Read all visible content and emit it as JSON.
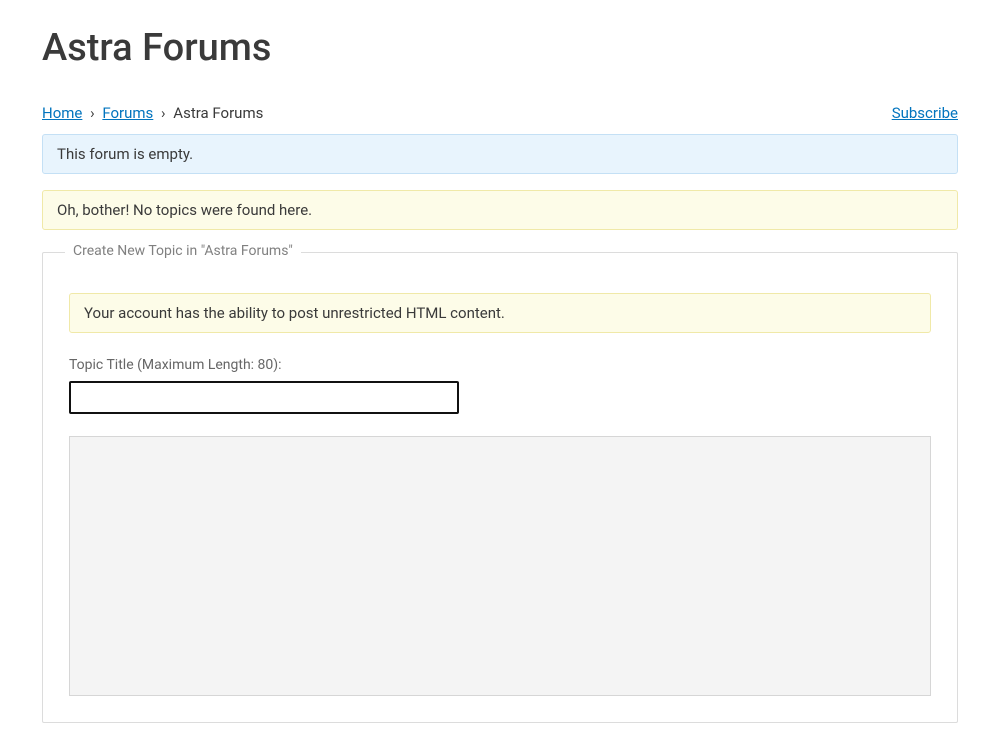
{
  "page": {
    "title": "Astra Forums"
  },
  "breadcrumb": {
    "home": "Home",
    "forums": "Forums",
    "current": "Astra Forums",
    "separator": "›"
  },
  "actions": {
    "subscribe": "Subscribe"
  },
  "notices": {
    "empty_forum": "This forum is empty.",
    "no_topics": "Oh, bother! No topics were found here."
  },
  "new_topic": {
    "legend": "Create New Topic in \"Astra Forums\"",
    "html_notice": "Your account has the ability to post unrestricted HTML content.",
    "title_label": "Topic Title (Maximum Length: 80):",
    "title_value": ""
  }
}
